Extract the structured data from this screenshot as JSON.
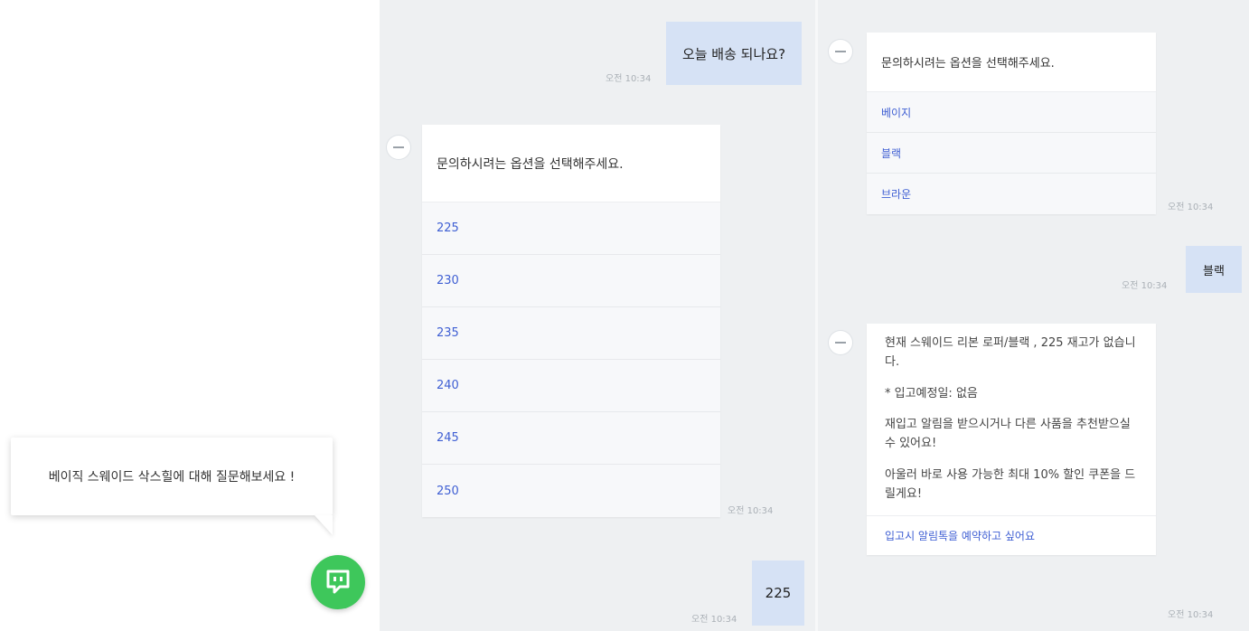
{
  "launcher": {
    "tooltip": "베이직 스웨이드 삭스힐에 대해 질문해보세요 !",
    "icon": "chat-icon",
    "color": "#3ec75b"
  },
  "left_chat": {
    "user_message_1": {
      "text": "오늘 배송 되나요?",
      "time": "오전 10:34"
    },
    "bot_options": {
      "prompt": "문의하시려는 옵션을 선택해주세요.",
      "options": [
        "225",
        "230",
        "235",
        "240",
        "245",
        "250"
      ],
      "time": "오전 10:34"
    },
    "user_message_2": {
      "text": "225",
      "time": "오전 10:34"
    }
  },
  "right_chat": {
    "bot_options": {
      "prompt": "문의하시려는 옵션을 선택해주세요.",
      "options": [
        "베이지",
        "블랙",
        "브라운"
      ],
      "time": "오전 10:34"
    },
    "user_message": {
      "text": "블랙",
      "time": "오전 10:34"
    },
    "bot_reply": {
      "line1": "현재 스웨이드 리본 로퍼/블랙 , 225 재고가 없습니다.",
      "line2": "* 입고예정일: 없음",
      "line3": "재입고 알림을 받으시거나 다른 사품을 추천받으실 수 있어요!",
      "line4": "아울러 바로 사용 가능한 최대 10% 할인 쿠폰을 드릴게요!",
      "action": "입고시 알림톡을 예약하고 싶어요",
      "time": "오전 10:34"
    }
  },
  "colors": {
    "panel_bg": "#eef0f2",
    "user_bubble": "#d6e2f5",
    "option_text": "#3f5fd3"
  }
}
